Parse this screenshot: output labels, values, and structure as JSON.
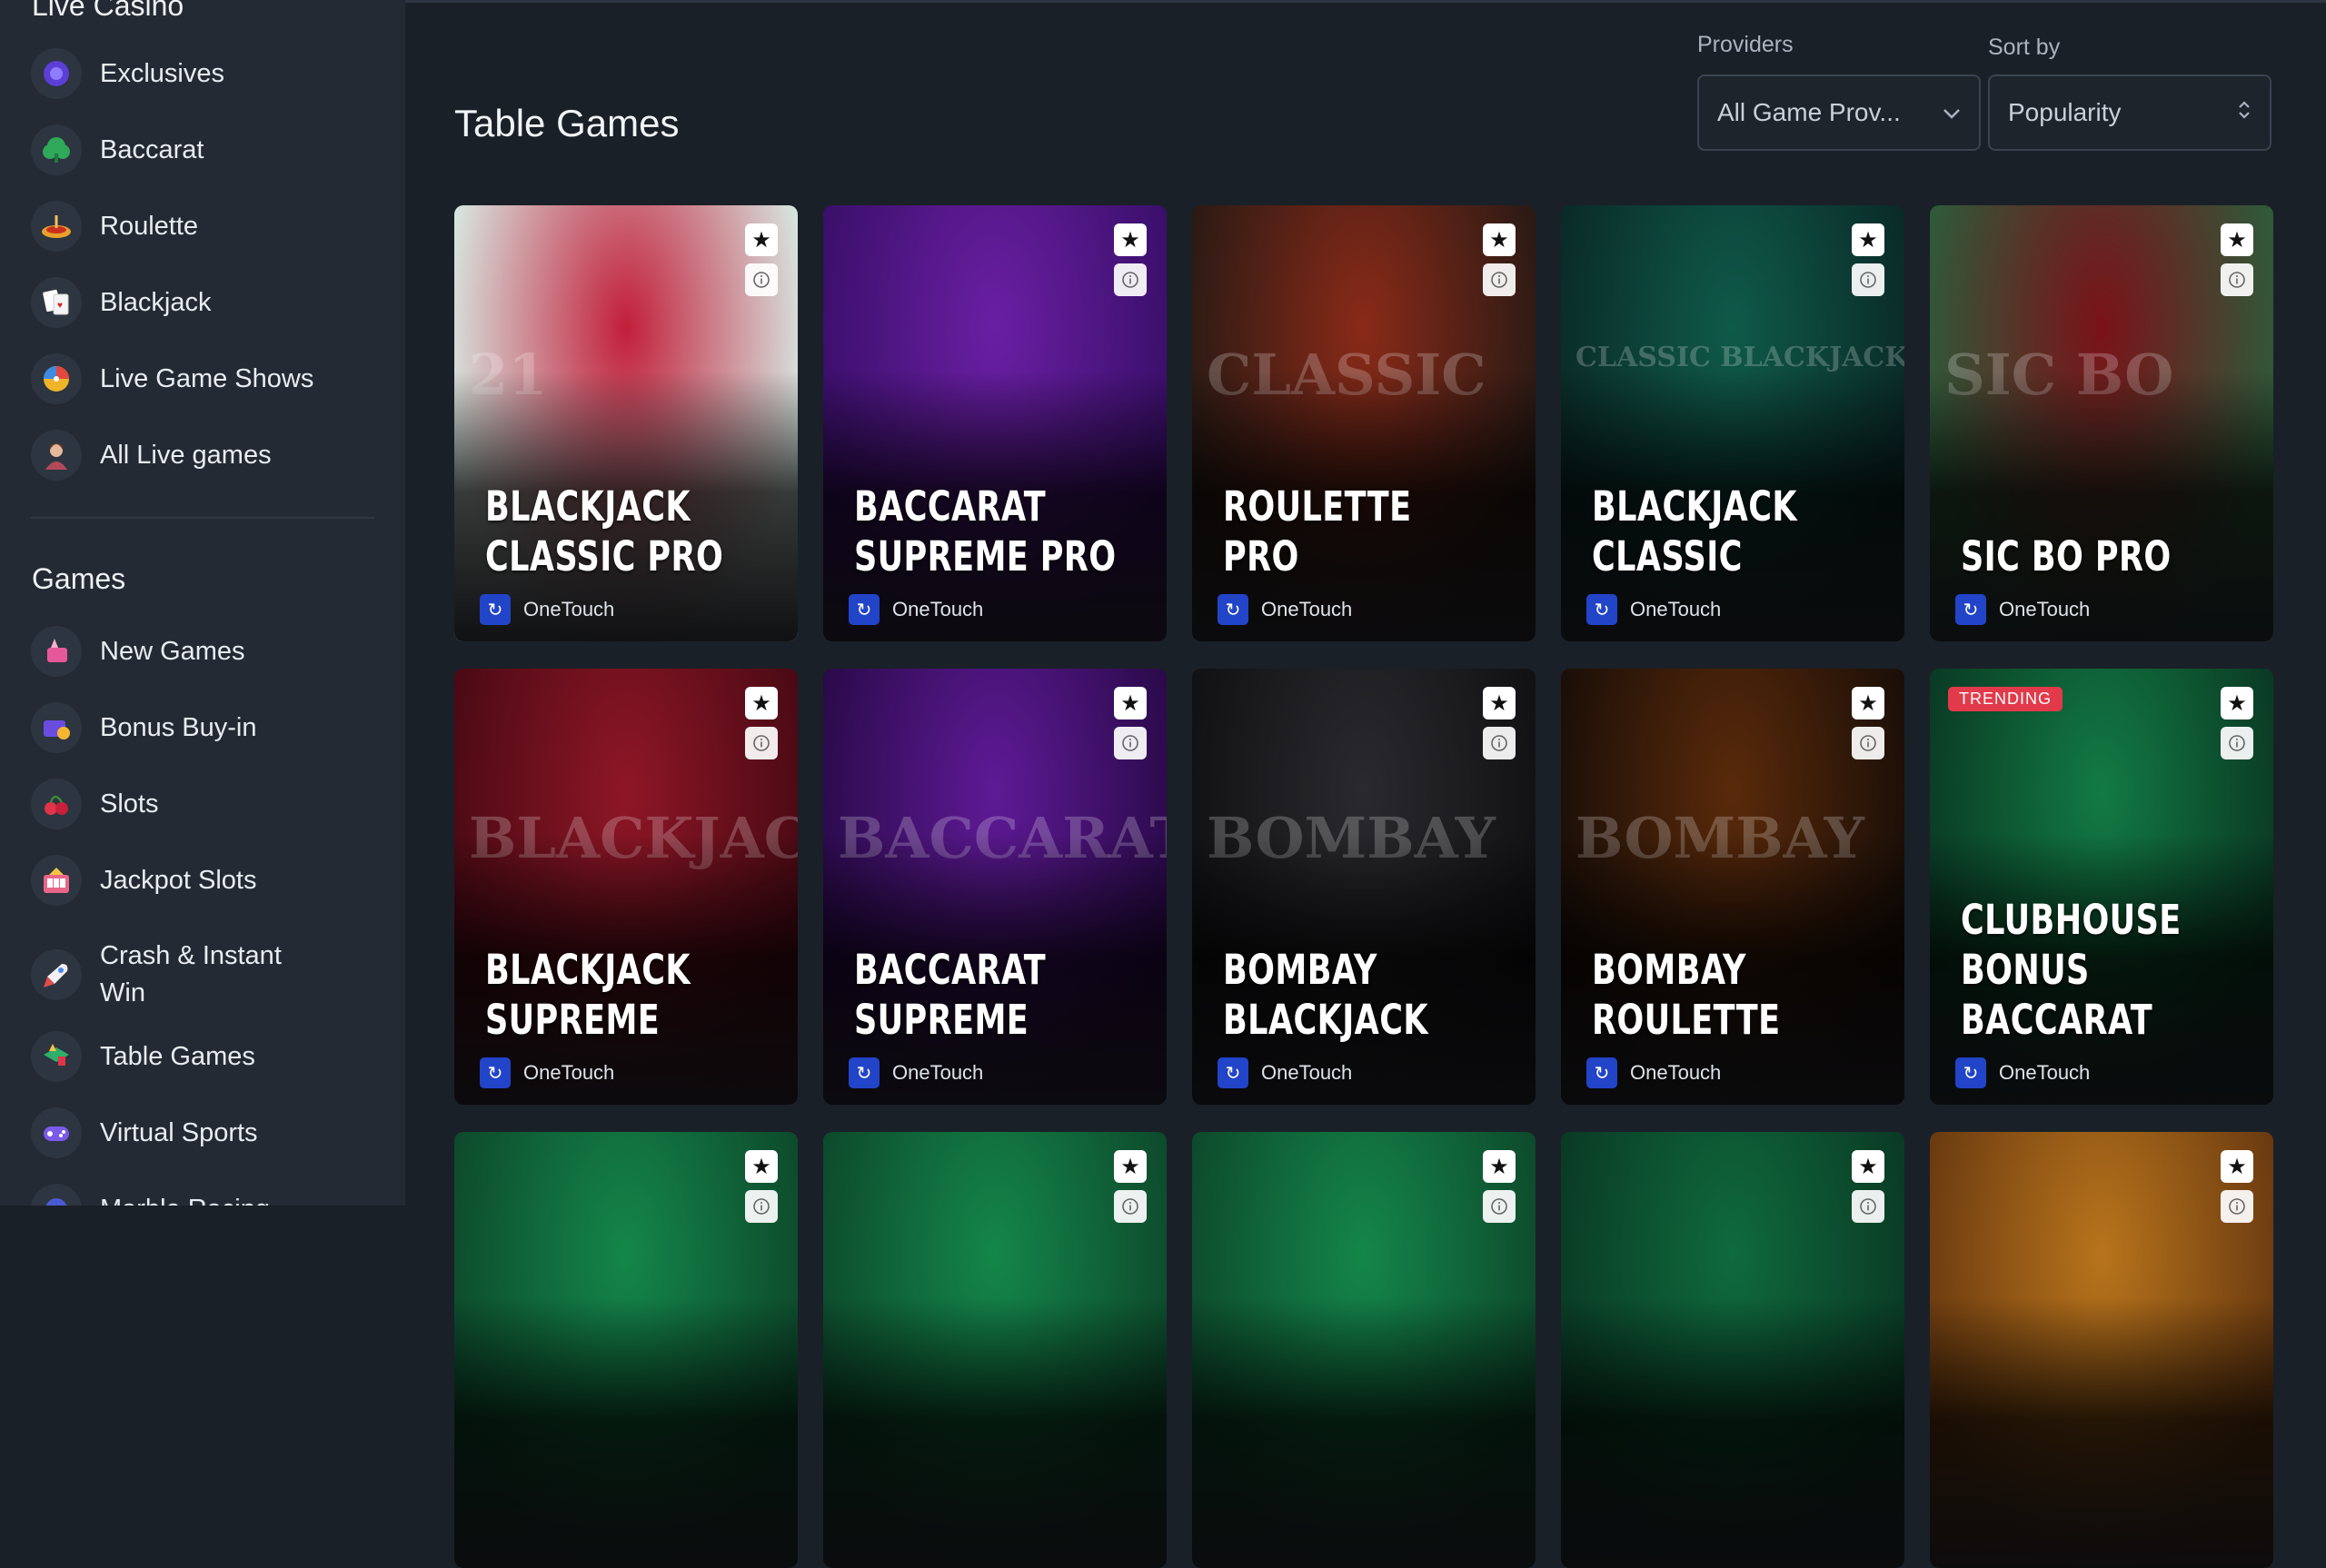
{
  "sidebar": {
    "section_live": "Live Casino",
    "live_items": [
      {
        "label": "Exclusives",
        "icon": "exclusives-icon"
      },
      {
        "label": "Baccarat",
        "icon": "baccarat-icon"
      },
      {
        "label": "Roulette",
        "icon": "roulette-icon"
      },
      {
        "label": "Blackjack",
        "icon": "blackjack-icon"
      },
      {
        "label": "Live Game Shows",
        "icon": "game-shows-icon"
      },
      {
        "label": "All Live games",
        "icon": "live-dealer-icon"
      }
    ],
    "section_games": "Games",
    "game_items": [
      {
        "label": "New Games",
        "icon": "new-games-icon"
      },
      {
        "label": "Bonus Buy-in",
        "icon": "bonus-buy-icon"
      },
      {
        "label": "Slots",
        "icon": "slots-icon"
      },
      {
        "label": "Jackpot Slots",
        "icon": "jackpot-icon"
      },
      {
        "label": "Crash & Instant Win",
        "icon": "rocket-icon"
      },
      {
        "label": "Table Games",
        "icon": "table-games-icon"
      },
      {
        "label": "Virtual Sports",
        "icon": "virtual-sports-icon"
      },
      {
        "label": "Marble Racing",
        "icon": "marble-icon"
      }
    ]
  },
  "main": {
    "title": "Table Games",
    "providers_label": "Providers",
    "providers_value": "All Game Prov...",
    "sort_label": "Sort by",
    "sort_value": "Popularity"
  },
  "games": [
    {
      "title_line1": "BLACKJACK",
      "title_line2": "CLASSIC PRO",
      "provider": "OneTouch",
      "bg": "#c21f3a",
      "bg2": "#d7e6e0",
      "deco": "21"
    },
    {
      "title_line1": "BACCARAT",
      "title_line2": "SUPREME PRO",
      "provider": "OneTouch",
      "bg": "#6a1fa3",
      "bg2": "#3a0f6a",
      "deco": ""
    },
    {
      "title_line1": "ROULETTE",
      "title_line2": "PRO",
      "provider": "OneTouch",
      "bg": "#8a2a18",
      "bg2": "#2a1a14",
      "deco": "CLASSIC"
    },
    {
      "title_line1": "BLACKJACK",
      "title_line2": "CLASSIC",
      "provider": "OneTouch",
      "bg": "#0f5a4a",
      "bg2": "#0a2a28",
      "deco": "CLASSIC BLACKJACK"
    },
    {
      "title_line1": "SIC BO PRO",
      "title_line2": "",
      "provider": "OneTouch",
      "bg": "#7a1218",
      "bg2": "#2e5a3a",
      "deco": "SIC BO"
    },
    {
      "title_line1": "BLACKJACK",
      "title_line2": "SUPREME",
      "provider": "OneTouch",
      "bg": "#8e1626",
      "bg2": "#4a0a14",
      "deco": "BLACKJACK"
    },
    {
      "title_line1": "BACCARAT",
      "title_line2": "SUPREME",
      "provider": "OneTouch",
      "bg": "#5e1a96",
      "bg2": "#2a0a4a",
      "deco": "BACCARAT"
    },
    {
      "title_line1": "BOMBAY",
      "title_line2": "BLACKJACK",
      "provider": "OneTouch",
      "bg": "#2a2a2e",
      "bg2": "#111114",
      "deco": "BOMBAY"
    },
    {
      "title_line1": "BOMBAY",
      "title_line2": "ROULETTE",
      "provider": "OneTouch",
      "bg": "#5a2a0a",
      "bg2": "#1a0e08",
      "deco": "BOMBAY"
    },
    {
      "title_line1": "CLUBHOUSE",
      "title_line2": "BONUS BACCARAT",
      "provider": "OneTouch",
      "bg": "#127a44",
      "bg2": "#0a3a24",
      "deco": "",
      "badge": "TRENDING"
    },
    {
      "title_line1": "",
      "title_line2": "",
      "provider": "",
      "bg": "#14864a",
      "bg2": "#0d4a2c",
      "deco": ""
    },
    {
      "title_line1": "",
      "title_line2": "",
      "provider": "",
      "bg": "#14864a",
      "bg2": "#0d4a2c",
      "deco": ""
    },
    {
      "title_line1": "",
      "title_line2": "",
      "provider": "",
      "bg": "#14864a",
      "bg2": "#0d4a2c",
      "deco": ""
    },
    {
      "title_line1": "",
      "title_line2": "",
      "provider": "",
      "bg": "#0f6a3e",
      "bg2": "#0a3a24",
      "deco": ""
    },
    {
      "title_line1": "",
      "title_line2": "",
      "provider": "",
      "bg": "#b8741c",
      "bg2": "#6a3a10",
      "deco": ""
    }
  ]
}
